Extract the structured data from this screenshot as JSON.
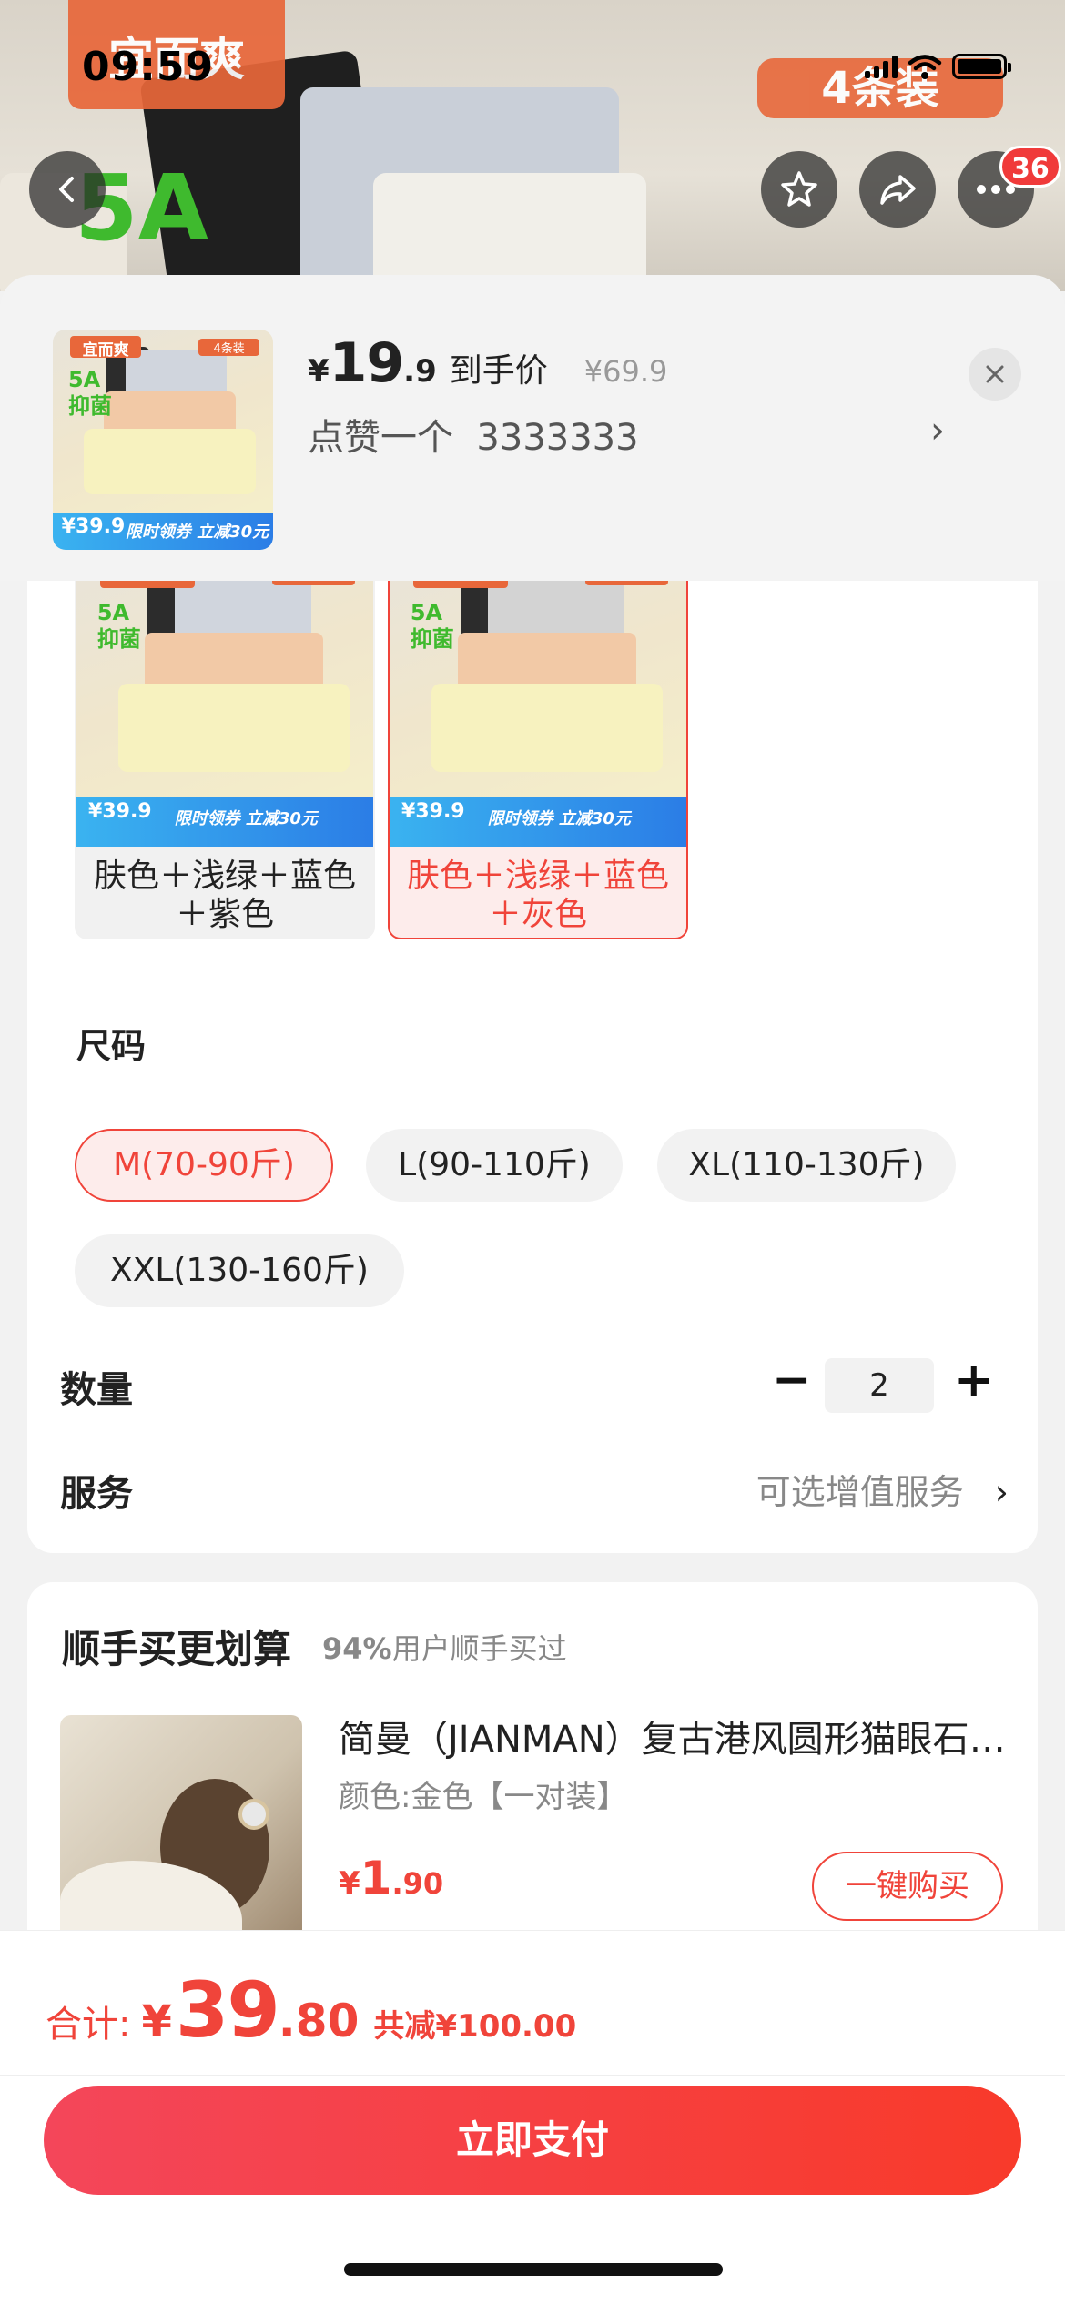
{
  "status_bar": {
    "time": "09:59"
  },
  "background": {
    "brand_logo": "宜而爽",
    "headline": "5A",
    "pack_label": "4条装"
  },
  "nav": {
    "back_icon": "chevron-left-icon",
    "favorite_icon": "star-icon",
    "share_icon": "share-icon",
    "more_icon": "more-icon",
    "badge_count": "36"
  },
  "header": {
    "price_symbol": "¥",
    "price_integer": "19",
    "price_decimal": ".9",
    "price_label": "到手价",
    "original_price": "¥69.9",
    "like_text": "点赞一个  3333333",
    "like_chevron": "›"
  },
  "product_art": {
    "logo": "宜而爽",
    "tag": "4条装",
    "headline": "5A\n抑菌",
    "price": "¥39.9",
    "coupon": "限时领券 立减30元"
  },
  "color_options": [
    {
      "label": "肤色＋浅绿＋蓝色＋紫色",
      "selected": false
    },
    {
      "label": "肤色＋浅绿＋蓝色＋灰色",
      "selected": true
    }
  ],
  "size": {
    "title": "尺码",
    "options": [
      {
        "label": "M(70-90斤)",
        "selected": true
      },
      {
        "label": "L(90-110斤)",
        "selected": false
      },
      {
        "label": "XL(110-130斤)",
        "selected": false
      },
      {
        "label": "XXL(130-160斤)",
        "selected": false
      }
    ]
  },
  "quantity": {
    "title": "数量",
    "minus": "−",
    "value": "2",
    "plus": "+"
  },
  "service": {
    "title": "服务",
    "value": "可选增值服务",
    "chevron": "›"
  },
  "bundle": {
    "title": "顺手买更划算",
    "subtitle_pct": "94%",
    "subtitle_text": "用户顺手买过",
    "item_name": "简曼（JIANMAN）复古港风圆形猫眼石耳钉",
    "item_spec": "颜色:金色【一对装】",
    "item_price_symbol": "¥",
    "item_price_integer": "1",
    "item_price_decimal": ".90",
    "buy_button": "一键购买"
  },
  "footer": {
    "total_label": "合计:",
    "total_symbol": "¥",
    "total_integer": "39",
    "total_decimal": ".80",
    "discount": "共减¥100.00",
    "pay_button": "立即支付"
  },
  "colors": {
    "accent": "#f0443a",
    "pay_gradient_start": "#f4465a",
    "pay_gradient_end": "#f83a2a"
  }
}
